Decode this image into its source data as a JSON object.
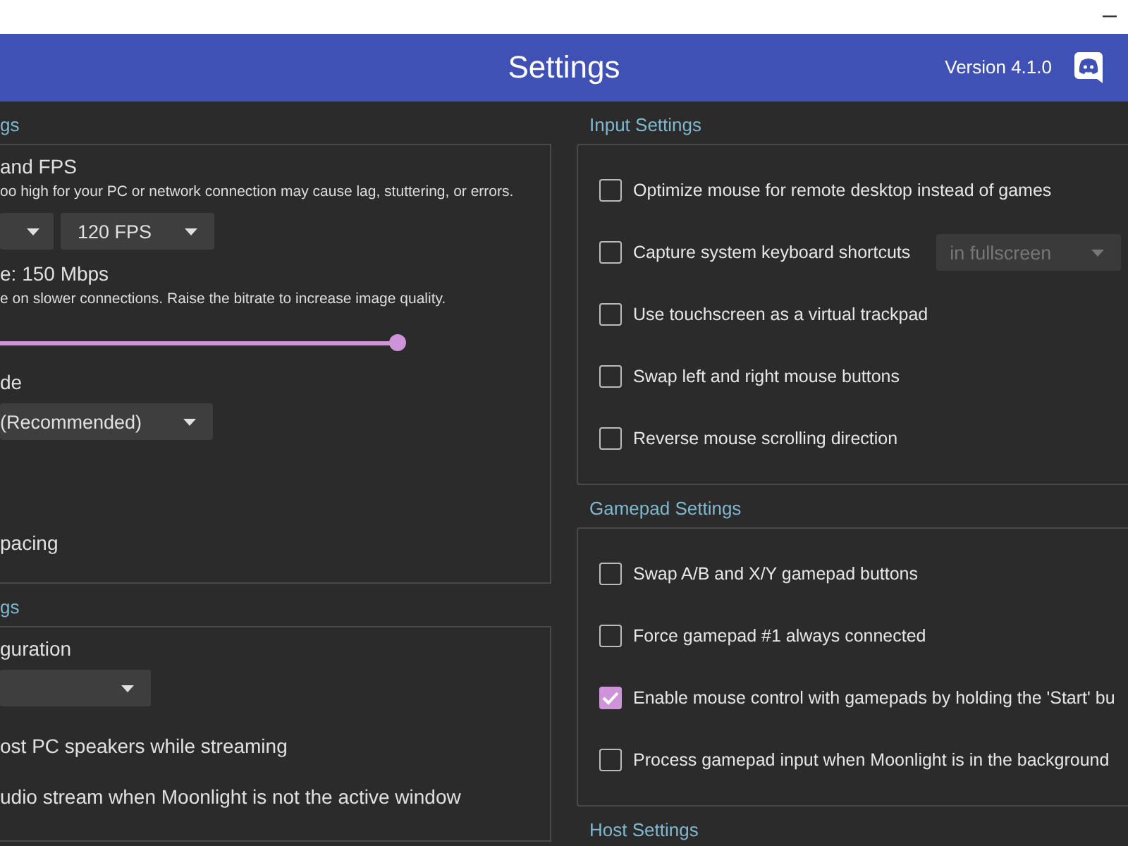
{
  "header": {
    "title": "Settings",
    "version": "Version 4.1.0"
  },
  "left_sections": [
    {
      "title": "gs",
      "items": [
        {
          "kind": "label",
          "text": "and FPS"
        },
        {
          "kind": "note",
          "text": "oo high for your PC or network connection may cause lag, stuttering, or errors."
        },
        {
          "kind": "selects",
          "selects": [
            {
              "partial": true
            },
            {
              "value": "120 FPS"
            }
          ]
        },
        {
          "kind": "label",
          "text": "e: 150 Mbps"
        },
        {
          "kind": "note",
          "text": "e on slower connections. Raise the bitrate to increase image quality."
        },
        {
          "kind": "slider",
          "level": 1.0
        },
        {
          "kind": "label",
          "text": "de"
        },
        {
          "kind": "select",
          "value": "(Recommended)"
        },
        {
          "kind": "check",
          "text": "pacing"
        }
      ]
    },
    {
      "title": "gs",
      "items": [
        {
          "kind": "label",
          "text": "guration"
        },
        {
          "kind": "select",
          "partial": true
        },
        {
          "kind": "check",
          "text": "ost PC speakers while streaming"
        },
        {
          "kind": "check",
          "text": "udio stream when Moonlight is not the active window"
        }
      ]
    }
  ],
  "right_sections": [
    {
      "title": "Input Settings",
      "items": [
        {
          "label": "Optimize mouse for remote desktop instead of games",
          "checked": false
        },
        {
          "label": "Capture system keyboard shortcuts",
          "checked": false,
          "select": {
            "value": "in fullscreen",
            "disabled": true
          }
        },
        {
          "label": "Use touchscreen as a virtual trackpad",
          "checked": false
        },
        {
          "label": "Swap left and right mouse buttons",
          "checked": false
        },
        {
          "label": "Reverse mouse scrolling direction",
          "checked": false
        }
      ]
    },
    {
      "title": "Gamepad Settings",
      "items": [
        {
          "label": "Swap A/B and X/Y gamepad buttons",
          "checked": false
        },
        {
          "label": "Force gamepad #1 always connected",
          "checked": false
        },
        {
          "label": "Enable mouse control with gamepads by holding the 'Start' bu",
          "checked": true
        },
        {
          "label": "Process gamepad input when Moonlight is in the background",
          "checked": false
        }
      ]
    },
    {
      "title": "Host Settings"
    }
  ]
}
